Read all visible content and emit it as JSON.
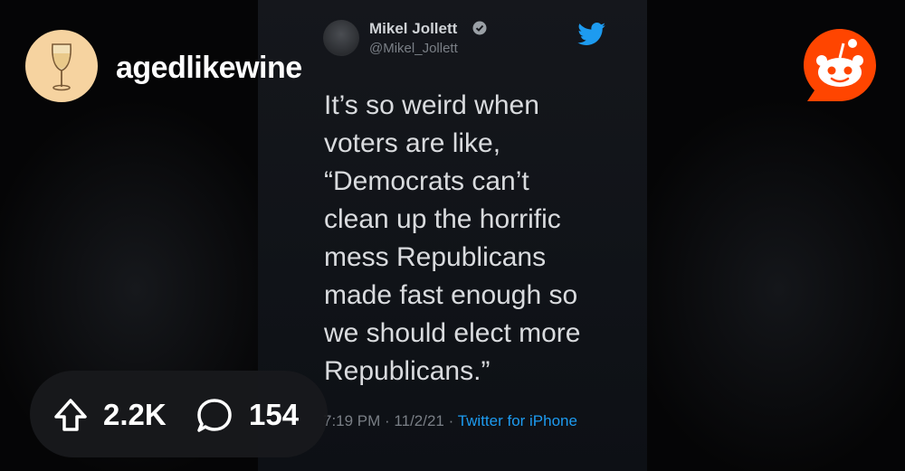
{
  "subreddit": {
    "name": "agedlikewine"
  },
  "tweet": {
    "author_name": "Mikel Jollett",
    "author_handle": "@Mikel_Jollett",
    "text": "It’s so weird when\nvoters are like,\n“Democrats can’t\nclean up the horrific\nmess Republicans\nmade fast enough so\nwe should elect more\nRepublicans.”",
    "timestamp": "7:19 PM · 11/2/21 · ",
    "source": "Twitter for iPhone"
  },
  "stats": {
    "upvotes": "2.2K",
    "comments": "154"
  },
  "icons": {
    "subreddit_avatar": "wine-glass-icon",
    "brand": "reddit-logo",
    "verified": "verified-badge-icon",
    "twitter": "twitter-bird-icon",
    "upvote": "upvote-arrow-icon",
    "comment": "comment-bubble-icon"
  },
  "colors": {
    "reddit_orange": "#ff4500",
    "twitter_blue": "#1d9bf0",
    "avatar_bg": "#f6d3a0"
  }
}
